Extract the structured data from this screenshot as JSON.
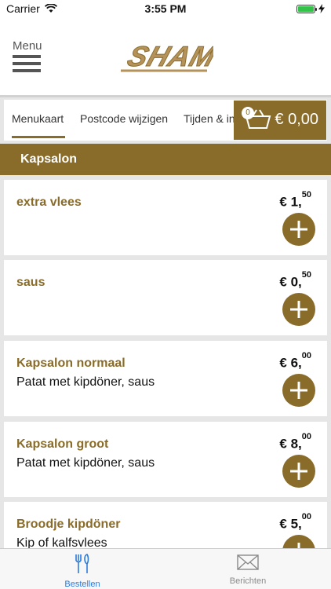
{
  "status": {
    "carrier": "Carrier",
    "time": "3:55 PM"
  },
  "header": {
    "menu_label": "Menu",
    "logo_text": "SHAM"
  },
  "tabs": [
    {
      "label": "Menukaart"
    },
    {
      "label": "Postcode wijzigen"
    },
    {
      "label": "Tijden & in"
    }
  ],
  "cart": {
    "count": "0",
    "total": "€ 0,00",
    "icon": "basket-icon"
  },
  "category": {
    "title": "Kapsalon"
  },
  "items": [
    {
      "name": "extra vlees",
      "desc": "",
      "price_main": "€ 1,",
      "price_cents": "50"
    },
    {
      "name": "saus",
      "desc": "",
      "price_main": "€ 0,",
      "price_cents": "50"
    },
    {
      "name": "Kapsalon normaal",
      "desc": "Patat met kipdöner, saus",
      "price_main": "€ 6,",
      "price_cents": "00"
    },
    {
      "name": "Kapsalon groot",
      "desc": "Patat met kipdöner, saus",
      "price_main": "€ 8,",
      "price_cents": "00"
    },
    {
      "name": "Broodje kipdöner",
      "desc": "Kip of kalfsvlees",
      "price_main": "€ 5,",
      "price_cents": "00"
    }
  ],
  "bottom_tabs": [
    {
      "label": "Bestellen",
      "icon": "fork-knife-icon"
    },
    {
      "label": "Berichten",
      "icon": "envelope-icon"
    }
  ],
  "colors": {
    "brand": "#8a6c2a",
    "active_tab": "#2b7bdc"
  }
}
